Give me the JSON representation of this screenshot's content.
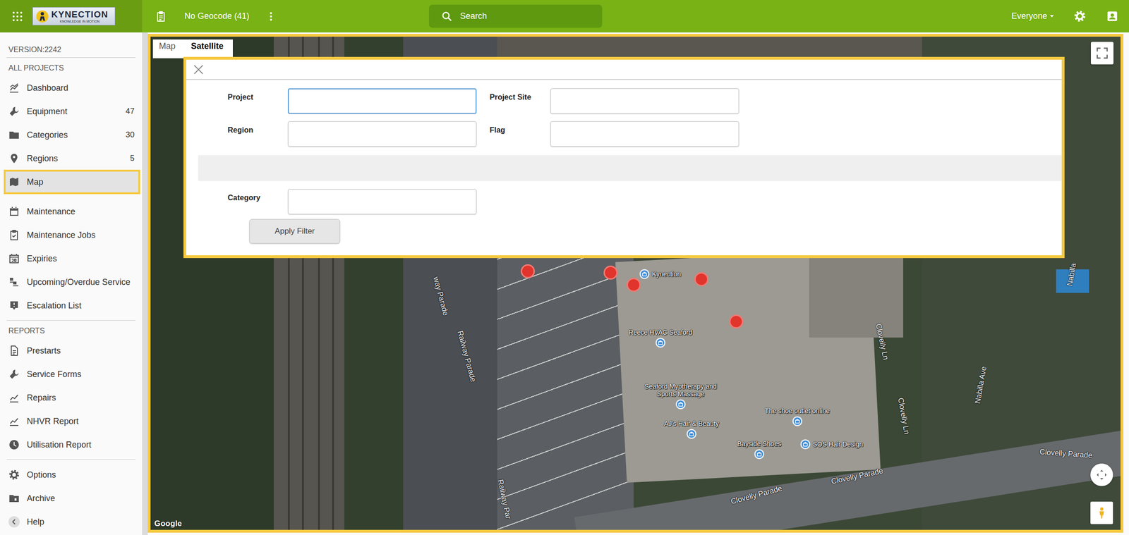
{
  "topbar": {
    "logo": {
      "name": "KYNECTION",
      "tagline": "KNOWLEDGE IN MOTION"
    },
    "geocode": "No Geocode (41)",
    "search": {
      "placeholder": "Search"
    },
    "user_filter": "Everyone"
  },
  "sidebar": {
    "version": "VERSION:2242",
    "sections": [
      {
        "title": "ALL PROJECTS",
        "items": [
          {
            "label": "Dashboard",
            "selected": false
          },
          {
            "label": "Equipment",
            "count": "47",
            "selected": false
          },
          {
            "label": "Categories",
            "count": "30",
            "selected": false
          },
          {
            "label": "Regions",
            "count": "5",
            "selected": false
          },
          {
            "label": "Map",
            "selected": true
          },
          {
            "label": "Maintenance",
            "selected": false
          },
          {
            "label": "Maintenance Jobs",
            "selected": false
          },
          {
            "label": "Expiries",
            "selected": false
          },
          {
            "label": "Upcoming/Overdue Service",
            "selected": false
          },
          {
            "label": "Escalation List",
            "selected": false
          }
        ]
      },
      {
        "title": "REPORTS",
        "items": [
          {
            "label": "Prestarts",
            "selected": false
          },
          {
            "label": "Service Forms",
            "selected": false
          },
          {
            "label": "Repairs",
            "selected": false
          },
          {
            "label": "NHVR Report",
            "selected": false
          },
          {
            "label": "Utilisation Report",
            "selected": false
          }
        ]
      }
    ],
    "footer_items": [
      {
        "label": "Options",
        "selected": false
      },
      {
        "label": "Archive",
        "selected": false
      },
      {
        "label": "Help",
        "selected": false
      }
    ]
  },
  "map": {
    "type_tabs": [
      {
        "label": "Map",
        "selected": false
      },
      {
        "label": "Satellite",
        "selected": true
      }
    ],
    "equipment_pins": 5,
    "places": [
      "Kynection",
      "Reece HVAC Seaford",
      "Seaford Myotherapy and Sports Massage",
      "AJ's Hair & Beauty",
      "The shoe outlet online",
      "Bayside Shoes",
      "SOS Hair Design"
    ],
    "streets": [
      "way Parade",
      "Railway Parade",
      "Railway Par",
      "Clovelly Ln",
      "Clovelly Ln",
      "Nabilla Ave",
      "Nabilla",
      "Clovelly Parade",
      "Clovelly Parade",
      "Clovelly Parade"
    ],
    "attribution": "Google"
  },
  "filter": {
    "fields": [
      {
        "label": "Project",
        "value": "",
        "focused": true
      },
      {
        "label": "Project Site",
        "value": "",
        "focused": false
      },
      {
        "label": "Region",
        "value": "",
        "focused": false
      },
      {
        "label": "Flag",
        "value": "",
        "focused": false
      }
    ],
    "extra_fields": [
      {
        "label": "Category",
        "value": "",
        "focused": false
      }
    ],
    "apply_button": "Apply Filter"
  }
}
